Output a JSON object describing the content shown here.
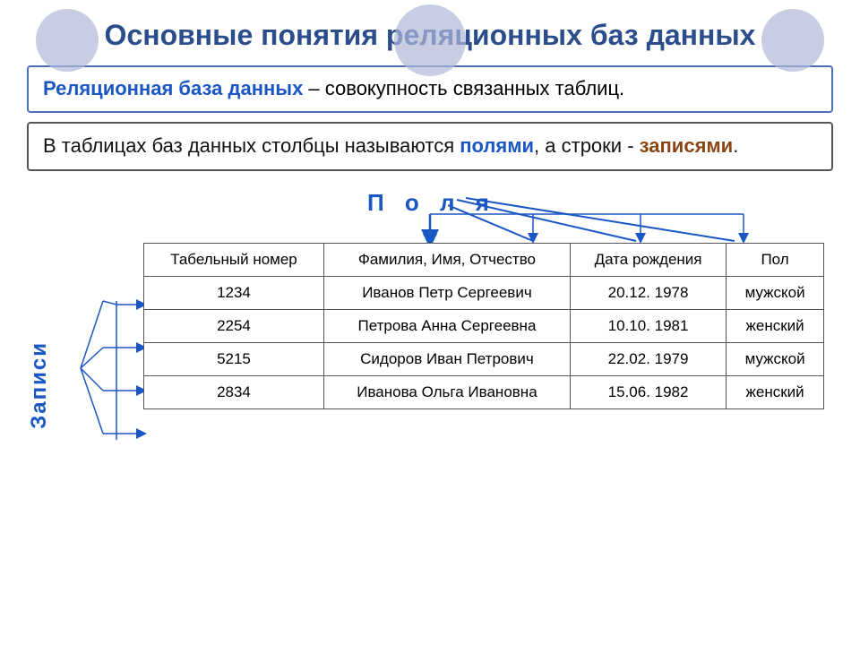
{
  "title": "Основные понятия реляционных баз данных",
  "definition": {
    "term": "Реляционная база данных",
    "rest": " – совокупность связанных таблиц."
  },
  "description": {
    "prefix": "В таблицах баз данных столбцы называются ",
    "field_term": "полями",
    "middle": ", а строки - ",
    "record_term": "записями",
    "suffix": "."
  },
  "label_polya": "П о л я",
  "label_zapisi": "Записи",
  "table": {
    "headers": [
      "Табельный номер",
      "Фамилия, Имя, Отчество",
      "Дата рождения",
      "Пол"
    ],
    "rows": [
      [
        "1234",
        "Иванов Петр Сергеевич",
        "20.12. 1978",
        "мужской"
      ],
      [
        "2254",
        "Петрова Анна Сергеевна",
        "10.10. 1981",
        "женский"
      ],
      [
        "5215",
        "Сидоров Иван Петрович",
        "22.02. 1979",
        "мужской"
      ],
      [
        "2834",
        "Иванова Ольга Ивановна",
        "15.06. 1982",
        "женский"
      ]
    ]
  },
  "decorative_circles": [
    "#b0b8d8",
    "#b0b8d8",
    "#b0b8d8"
  ]
}
